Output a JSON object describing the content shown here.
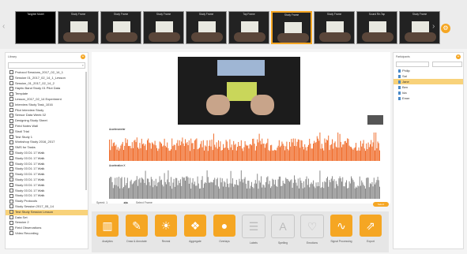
{
  "filmstrip": {
    "thumbs": [
      {
        "caption": "Tangible Model"
      },
      {
        "caption": "Study Frame"
      },
      {
        "caption": "Study Frame"
      },
      {
        "caption": "Study Frame"
      },
      {
        "caption": "Study Frame"
      },
      {
        "caption": "Tap Frame"
      },
      {
        "caption": "Study Frame"
      },
      {
        "caption": "Study Frame"
      },
      {
        "caption": "Sound Re-Tap"
      },
      {
        "caption": "Study Frame"
      }
    ],
    "selected_index": 6
  },
  "left_panel": {
    "title": "Library",
    "search_placeholder": "Search",
    "items": [
      "Protocol Sessions_2017_02_14_1",
      "Session 01_2017_02_14_1_Lesson",
      "Session_01_2017_02_14_2",
      "Haptic Band Study 01 Pilot Data",
      "Template",
      "Lesson_2017_02_14 Experiment",
      "Interview Study Task_1016",
      "Pilot Interview Study",
      "Sensor Data Week 02",
      "Designing Study Sheet",
      "Field Notes Wall",
      "Stroll Trial",
      "Test Study 1",
      "Workshop Study 2016_2017",
      "SMS for Tasks",
      "Study 03 D1 17 Walk",
      "Study 03 D1 17 Walk",
      "Study 03 D1 17 Walk",
      "Study 03 D1 17 Walk",
      "Study 03 D1 17 Walk",
      "Study 03 D1 17 Walk",
      "Study 03 D1 17 Walk",
      "Study 03 D1 17 Walk",
      "Study 03 D1 17 Walk",
      "Study Protocols",
      "Study Session 2017_05_14",
      "Test Study Session Lesson",
      "Data Set",
      "Session 2",
      "Field Observations",
      "Video Recording"
    ],
    "selected_index": 26
  },
  "right_panel": {
    "title": "Participants",
    "filter_a": "Group",
    "filter_b": "",
    "participants": [
      "Philip",
      "Sal",
      "Jane",
      "Ben",
      "Ida",
      "Emer"
    ],
    "selected_index": 2
  },
  "charts_legend": {
    "top": "Accelerometer",
    "bottom": "Acceleration X"
  },
  "chart_data": [
    {
      "type": "bar",
      "title": "",
      "series": [
        {
          "name": "Accelerometer",
          "color": "#f07030"
        }
      ],
      "note": "dense signal, roughly 0.3 to 1.0 of range"
    },
    {
      "type": "bar",
      "title": "",
      "series": [
        {
          "name": "Acceleration X",
          "color": "#8c8c8c"
        }
      ],
      "note": "dense signal, roughly 0.2 to 0.9 of range"
    }
  ],
  "playback": {
    "speed": "Speed: 1",
    "loop": "Select Frame",
    "button": "Select"
  },
  "actions": [
    {
      "label": "Analytics",
      "icon": "chart-icon",
      "enabled": true
    },
    {
      "label": "Draw & Annotate",
      "icon": "annotate-icon",
      "enabled": true
    },
    {
      "label": "Reveal",
      "icon": "bulb-icon",
      "enabled": true
    },
    {
      "label": "Aggregate",
      "icon": "aggregate-icon",
      "enabled": true
    },
    {
      "label": "Overlays",
      "icon": "circles-icon",
      "enabled": true
    },
    {
      "label": "Labels",
      "icon": "list-icon",
      "enabled": false
    },
    {
      "label": "Spelling",
      "icon": "text-icon",
      "enabled": false
    },
    {
      "label": "Emotions",
      "icon": "heart-icon",
      "enabled": false
    },
    {
      "label": "Signal Processing",
      "icon": "wave-icon",
      "enabled": true
    },
    {
      "label": "Export",
      "icon": "export-icon",
      "enabled": true
    }
  ],
  "colors": {
    "accent": "#f5a623",
    "signal_orange": "#f07030",
    "signal_gray": "#8c8c8c"
  }
}
